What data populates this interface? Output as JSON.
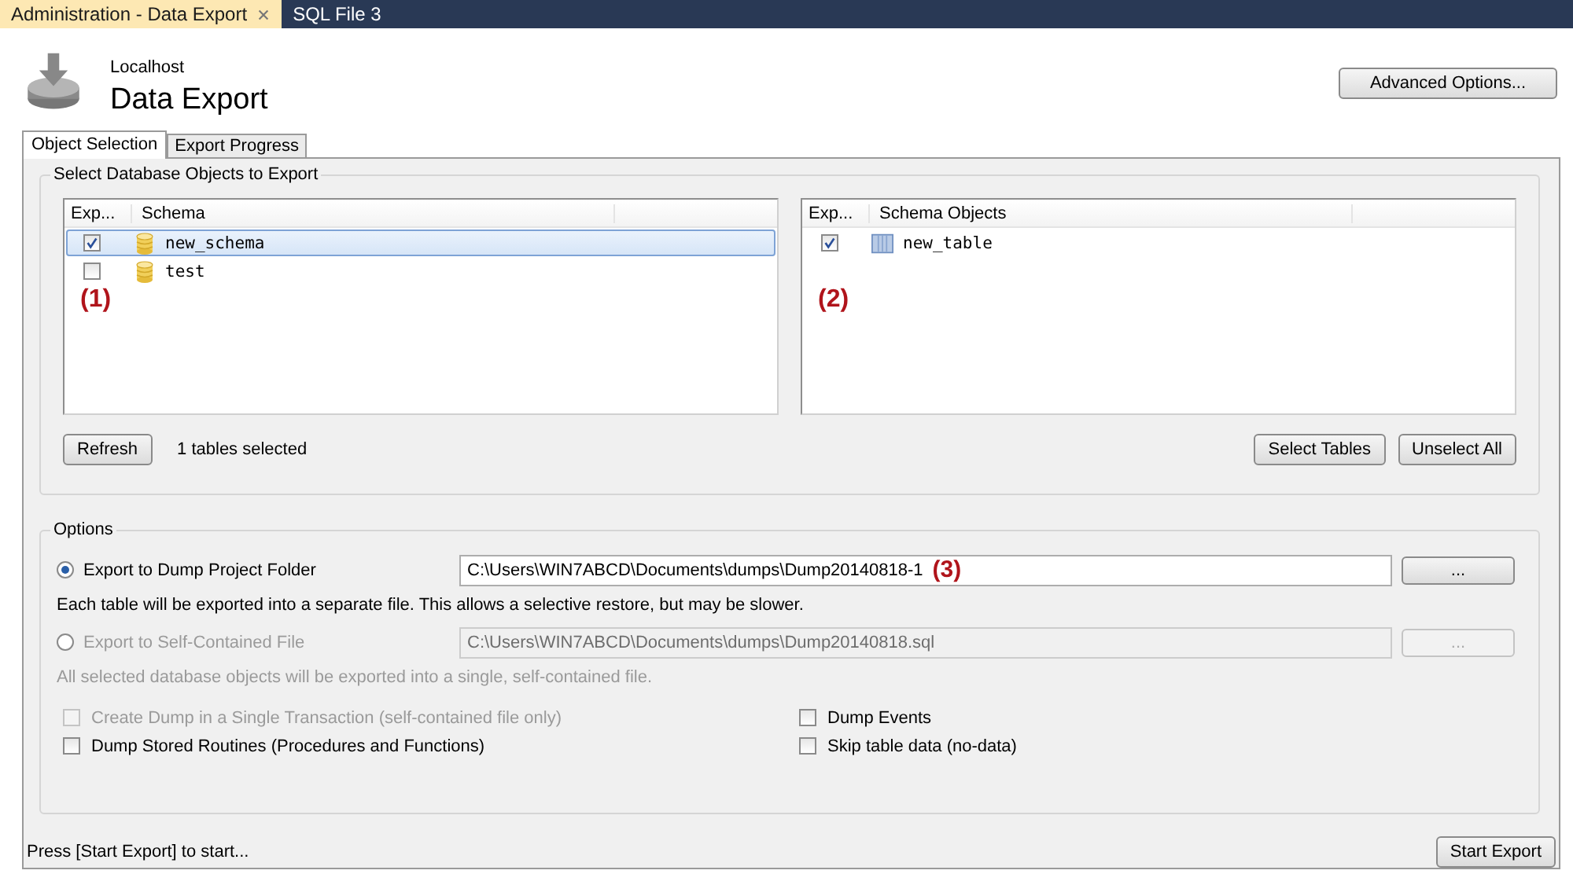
{
  "tabs": [
    {
      "label": "Administration - Data Export",
      "selected": true
    },
    {
      "label": "SQL File 3",
      "selected": false
    }
  ],
  "header": {
    "host": "Localhost",
    "title": "Data Export",
    "advanced_button": "Advanced Options..."
  },
  "page_tabs": [
    {
      "label": "Object Selection",
      "selected": true
    },
    {
      "label": "Export Progress",
      "selected": false
    }
  ],
  "objects_group": {
    "title": "Select Database Objects to Export",
    "lists": [
      {
        "columns": [
          "Exp...",
          "Schema"
        ],
        "annotation": "(1)",
        "rows": [
          {
            "name": "new_schema",
            "kind": "schema",
            "checked": true,
            "selected": true
          },
          {
            "name": "test",
            "kind": "schema",
            "checked": false,
            "selected": false
          }
        ]
      },
      {
        "columns": [
          "Exp...",
          "Schema Objects"
        ],
        "annotation": "(2)",
        "rows": [
          {
            "name": "new_table",
            "kind": "table",
            "checked": true,
            "selected": false
          }
        ]
      }
    ],
    "refresh_button": "Refresh",
    "selection_count": "1 tables selected",
    "select_tables_button": "Select Tables",
    "unselect_all_button": "Unselect All"
  },
  "options": {
    "title": "Options",
    "modes": [
      {
        "label": "Export to Dump Project Folder",
        "selected": true,
        "path": "C:\\Users\\WIN7ABCD\\Documents\\dumps\\Dump20140818-1",
        "annotation": "(3)",
        "browse_button": "...",
        "description": "Each table will be exported into a separate file. This allows a selective restore, but may be slower."
      },
      {
        "label": "Export to Self-Contained File",
        "selected": false,
        "path": "C:\\Users\\WIN7ABCD\\Documents\\dumps\\Dump20140818.sql",
        "browse_button": "...",
        "description": "All selected database objects will be exported into a single, self-contained file."
      }
    ],
    "checkboxes": [
      {
        "label": "Create Dump in a Single Transaction (self-contained file only)",
        "checked": false,
        "disabled": true
      },
      {
        "label": "Dump Events",
        "checked": false,
        "disabled": false
      },
      {
        "label": "Dump Stored Routines (Procedures and Functions)",
        "checked": false,
        "disabled": false
      },
      {
        "label": "Skip table data (no-data)",
        "checked": false,
        "disabled": false
      }
    ]
  },
  "status": "Press [Start Export] to start...",
  "start_button": "Start Export"
}
